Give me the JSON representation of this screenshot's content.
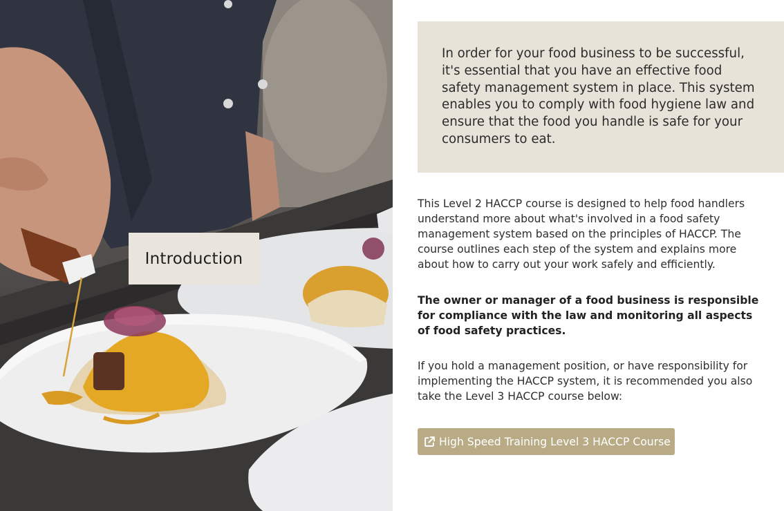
{
  "hero": {
    "image_description_icon": "chef-plating-image",
    "card_label": "Introduction"
  },
  "callout": {
    "text": "In order for your food business to be successful, it's essential that you have an effective food safety management system in place. This system enables you to comply with food hygiene law and ensure that the food you handle is safe for your consumers to eat."
  },
  "content": {
    "paragraph_1": "This Level 2 HACCP course is designed to help food handlers understand more about what's involved in a food safety management system based on the principles of HACCP. The course outlines each step of the system and explains more about how to carry out your work safely and efficiently.",
    "paragraph_2": "The owner or manager of a food business is responsible for compliance with the law and monitoring all aspects of food safety practices.",
    "paragraph_3": "If you hold a management position, or have responsibility for implementing the HACCP system, it is recommended you also take the Level 3 HACCP course below:"
  },
  "link_button": {
    "label": "High Speed Training Level 3 HACCP Course",
    "icon": "external-link-icon"
  },
  "colors": {
    "callout_bg": "#e7e3d8",
    "button_bg": "#b8ab86",
    "card_bg": "#e9e5dc"
  }
}
